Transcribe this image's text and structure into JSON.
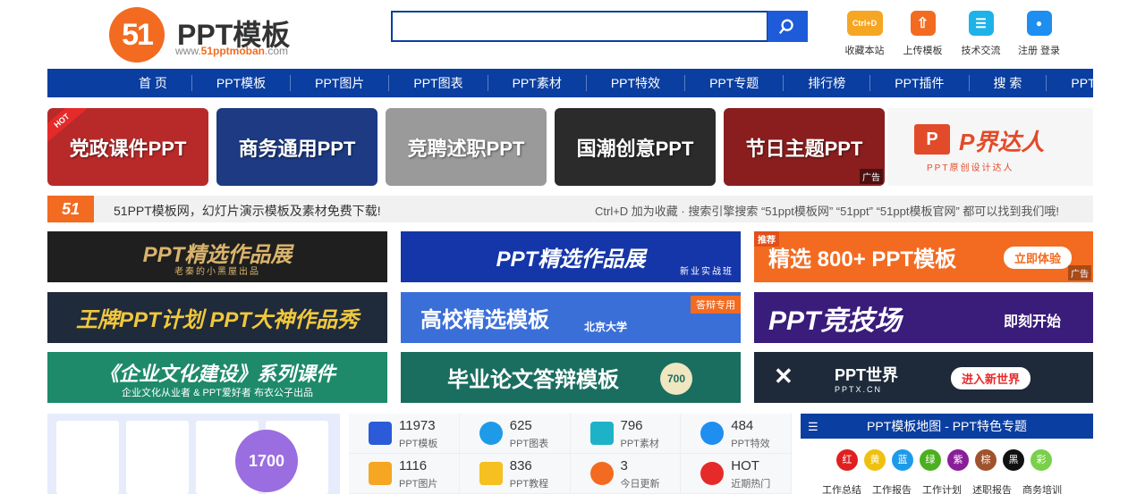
{
  "header": {
    "logo_mark": "51",
    "logo_title": "PPT模板",
    "logo_url_prefix": "www.",
    "logo_url_brand": "51pptmoban",
    "logo_url_suffix": ".com",
    "search_placeholder": "",
    "tools": [
      {
        "label": "收藏本站",
        "icon": "ctrl-d-icon",
        "icon_text": "Ctrl+D",
        "color": "#f5a623"
      },
      {
        "label": "上传模板",
        "icon": "upload-icon",
        "icon_text": "⇧",
        "color": "#f26b21"
      },
      {
        "label": "技术交流",
        "icon": "chat-icon",
        "icon_text": "☰",
        "color": "#1eb2e8"
      },
      {
        "label": "注册 登录",
        "icon": "user-icon",
        "icon_text": "●",
        "color": "#1e8ef0"
      }
    ]
  },
  "nav": [
    "首 页",
    "PPT模板",
    "PPT图片",
    "PPT图表",
    "PPT素材",
    "PPT特效",
    "PPT专题",
    "排行榜",
    "PPT插件",
    "搜 索",
    "PPT教程"
  ],
  "categories": [
    {
      "label": "党政课件PPT",
      "tag": "HOT",
      "bg": "#b82a2a"
    },
    {
      "label": "商务通用PPT",
      "bg": "#1d3a82"
    },
    {
      "label": "竞聘述职PPT",
      "bg": "#9a9a9a"
    },
    {
      "label": "国潮创意PPT",
      "bg": "#2b2b2b"
    },
    {
      "label": "节日主题PPT",
      "tag": "广告",
      "bg": "#8a1e1e"
    }
  ],
  "pjds": {
    "logo": "P",
    "title": "P界达人",
    "subtitle": "PPT原创设计达人"
  },
  "notice": {
    "logo": "51",
    "left": "51PPT模板网，幻灯片演示模板及素材免费下载!",
    "right": "Ctrl+D 加为收藏 · 搜索引擎搜索 “51ppt模板网” “51ppt” “51ppt模板官网” 都可以找到我们哦!"
  },
  "ads": [
    {
      "title": "PPT精选作品展",
      "sub": "老秦的小黑屋出品",
      "bg": "#1f1f1f",
      "fg": "#d9b36c"
    },
    {
      "title": "PPT精选作品展",
      "sub": "新业实战班",
      "bg": "#1536a8",
      "fg": "#ffffff"
    },
    {
      "title": "精选 800+ PPT模板",
      "tag": "推荐",
      "btn": "立即体验",
      "ad": "广告",
      "bg": "#f26b21",
      "fg": "#ffffff"
    },
    {
      "title": "王牌PPT计划  PPT大神作品秀",
      "sub": "",
      "bg": "#1f2a3a",
      "fg": "#f0c83c"
    },
    {
      "title": "高校精选模板",
      "sub": "北京大学",
      "tag": "答辩专用",
      "bg": "#3a6fd8",
      "fg": "#ffffff"
    },
    {
      "title": "PPT竞技场",
      "btn": "即刻开始",
      "bg": "#3a1c7a",
      "fg": "#ffffff"
    },
    {
      "title": "《企业文化建设》系列课件",
      "sub": "企业文化从业者 & PPT爱好者 布衣公子出品",
      "bg": "#1e8a6a",
      "fg": "#ffffff"
    },
    {
      "title": "毕业论文答辩模板",
      "badge": "700",
      "bg": "#1a6e60",
      "fg": "#ffffff"
    },
    {
      "title": "PPT世界",
      "sub": "PPTX.CN",
      "btn": "进入新世界",
      "bg": "#1e2a3a",
      "fg": "#ffffff"
    }
  ],
  "thumbs_badge": "1700",
  "stats": [
    {
      "num": "11973",
      "label": "PPT模板",
      "icon": "ppt-file-icon",
      "color": "#2b5bd8"
    },
    {
      "num": "625",
      "label": "PPT图表",
      "icon": "pie-chart-icon",
      "color": "#1e9be8"
    },
    {
      "num": "796",
      "label": "PPT素材",
      "icon": "material-icon",
      "color": "#1eb2c8"
    },
    {
      "num": "484",
      "label": "PPT特效",
      "icon": "effect-icon",
      "color": "#1e8ef0"
    },
    {
      "num": "1116",
      "label": "PPT图片",
      "icon": "image-icon",
      "color": "#f5a623"
    },
    {
      "num": "836",
      "label": "PPT教程",
      "icon": "tutorial-icon",
      "color": "#f5c020"
    },
    {
      "num": "3",
      "label": "今日更新",
      "icon": "refresh-icon",
      "color": "#f26b21"
    },
    {
      "num": "HOT",
      "label": "近期热门",
      "icon": "hot-icon",
      "color": "#e62a2a"
    }
  ],
  "map": {
    "title": "PPT模板地图 - PPT特色专题",
    "colors": [
      {
        "label": "红",
        "color": "#e02020"
      },
      {
        "label": "黄",
        "color": "#f0c010"
      },
      {
        "label": "蓝",
        "color": "#1e9be8"
      },
      {
        "label": "绿",
        "color": "#4caf20"
      },
      {
        "label": "紫",
        "color": "#8a1e9a"
      },
      {
        "label": "棕",
        "color": "#a0522d"
      },
      {
        "label": "黑",
        "color": "#111111"
      },
      {
        "label": "彩",
        "color": "#7ad04a"
      }
    ],
    "topics": [
      "工作总结",
      "工作报告",
      "工作计划",
      "述职报告",
      "商务培训"
    ]
  }
}
